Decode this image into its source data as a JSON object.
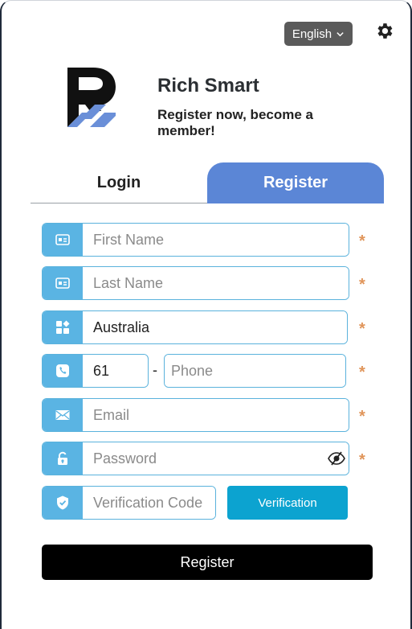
{
  "header": {
    "language": "English",
    "language_icon": "chevron-down-icon",
    "settings_icon": "gear-icon"
  },
  "brand": {
    "name": "Rich Smart",
    "tagline": "Register now, become a member!"
  },
  "tabs": [
    {
      "label": "Login",
      "active": false
    },
    {
      "label": "Register",
      "active": true
    }
  ],
  "form": {
    "first_name": {
      "placeholder": "First Name",
      "value": "",
      "icon": "id-card-icon"
    },
    "last_name": {
      "placeholder": "Last Name",
      "value": "",
      "icon": "id-card-icon"
    },
    "country": {
      "value": "Australia",
      "icon": "grid-icon"
    },
    "phone": {
      "code": "61",
      "separator": "-",
      "placeholder": "Phone",
      "value": "",
      "icon": "phone-icon"
    },
    "email": {
      "placeholder": "Email",
      "value": "",
      "icon": "envelope-icon"
    },
    "password": {
      "placeholder": "Password",
      "value": "",
      "icon": "lock-icon",
      "toggle_icon": "eye-hidden-icon"
    },
    "verification": {
      "placeholder": "Verification Code",
      "value": "",
      "icon": "shield-icon",
      "button_label": "Verification"
    },
    "required_mark": "*",
    "submit_label": "Register"
  },
  "colors": {
    "accent_tab": "#5b86d6",
    "icon_bg": "#5ab4e3",
    "field_border": "#5ab2dc",
    "verify_button": "#0ca3d0",
    "required": "#e0955a",
    "submit_button": "#000000"
  }
}
